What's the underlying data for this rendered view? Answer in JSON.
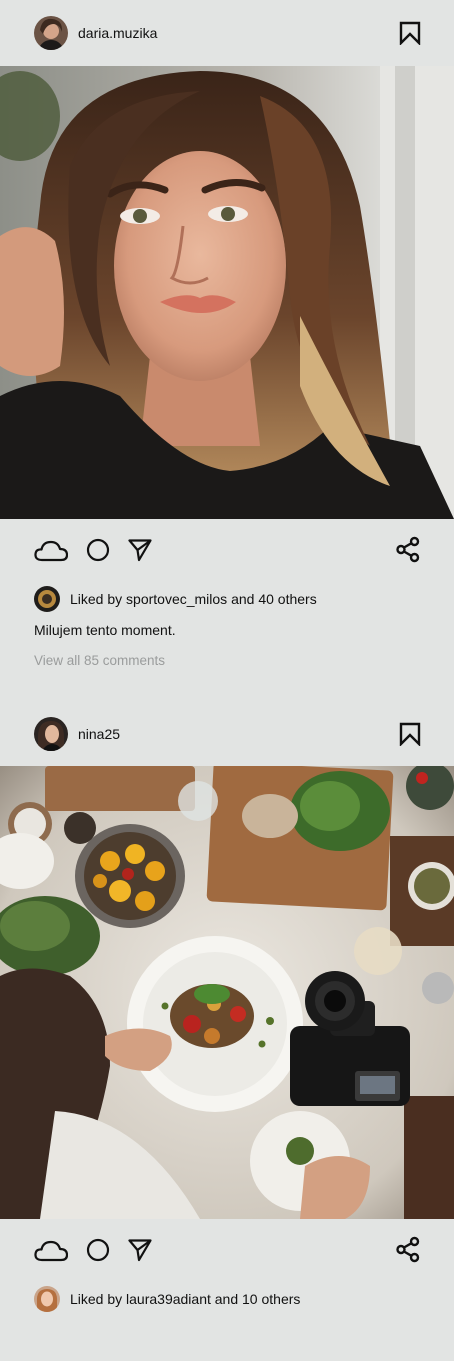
{
  "posts": [
    {
      "username": "daria.muzika",
      "likes_text": "Liked by sportovec_milos and 40 others",
      "caption": "Milujem tento moment.",
      "comments_link": "View all 85 comments"
    },
    {
      "username": "nina25",
      "likes_text": "Liked by laura39adiant and 10 others"
    }
  ],
  "icons": {
    "like": "cloud-icon",
    "comment": "circle-icon",
    "send": "send-arrow-icon",
    "share": "share-icon",
    "save": "bookmark-icon"
  },
  "colors": {
    "background": "#e2e4e3",
    "text": "#111111",
    "muted": "#9a9c9c"
  }
}
